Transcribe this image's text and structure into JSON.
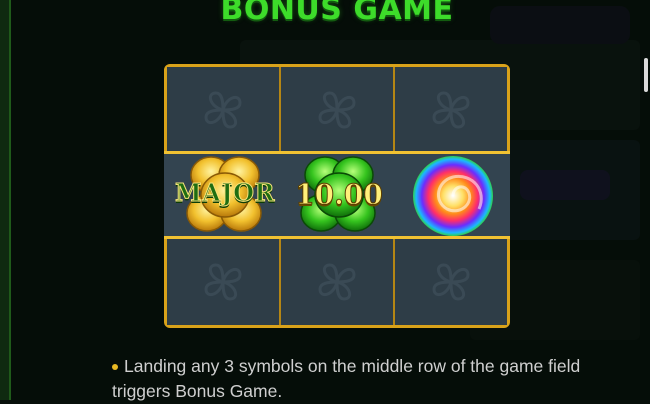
{
  "title": "BONUS GAME",
  "grid": {
    "rows": 3,
    "columns": 3,
    "frame_color": "#d9a21a",
    "middle_row_symbols": [
      {
        "kind": "gold-clover",
        "label": "MAJOR",
        "color": "#e8b923"
      },
      {
        "kind": "green-clover",
        "label": "10.00",
        "color": "#2fbf1e"
      },
      {
        "kind": "rainbow-swirl",
        "label": "",
        "color": "#ff4a8a"
      }
    ]
  },
  "rules": {
    "bullet": "Landing any 3 symbols on the middle row of the game field triggers Bonus Game."
  },
  "icons": [
    "clover-ghost-icon",
    "scrollbar-thumb"
  ]
}
